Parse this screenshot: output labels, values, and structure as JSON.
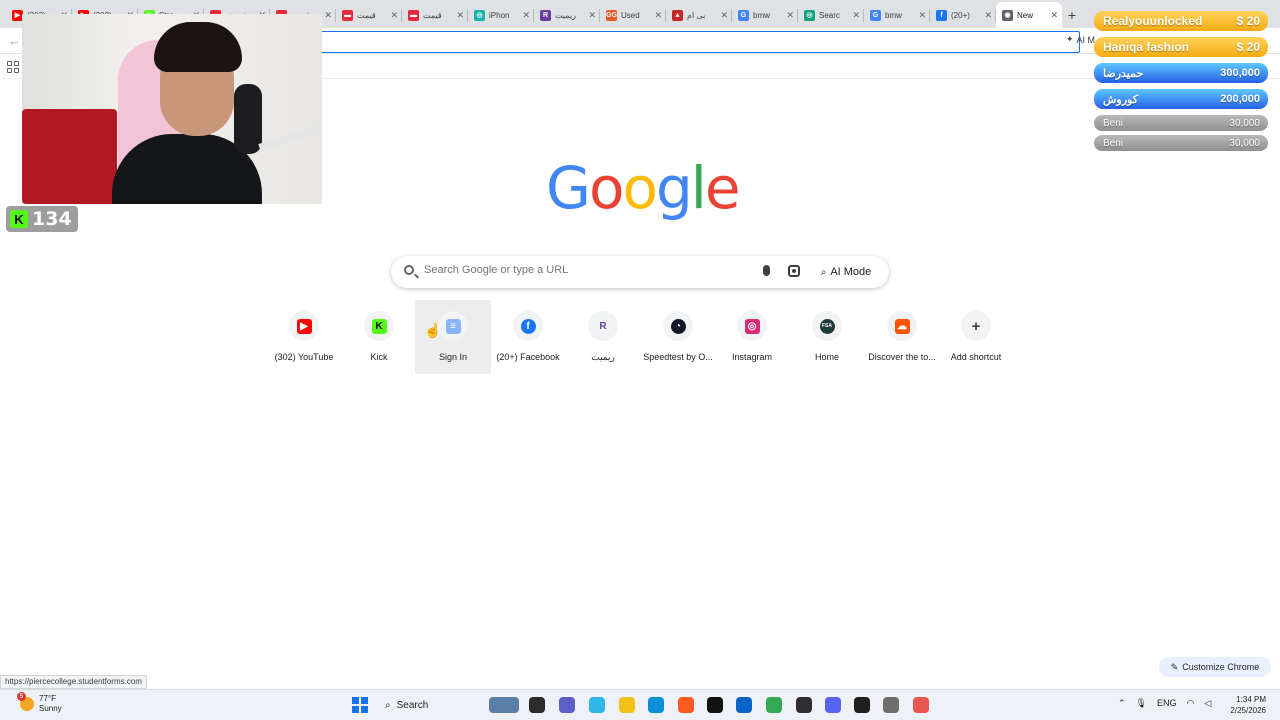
{
  "tabs": [
    {
      "title": "(303)",
      "color": "#ff0000",
      "glyph": "▶"
    },
    {
      "title": "(303)",
      "color": "#ff0000",
      "glyph": "▶"
    },
    {
      "title": "Stre",
      "color": "#53fc18",
      "glyph": "K"
    },
    {
      "title": "فروش",
      "color": "#e8283c",
      "glyph": "▬"
    },
    {
      "title": "قیمت",
      "color": "#e8283c",
      "glyph": "▬"
    },
    {
      "title": "قیمت",
      "color": "#e8283c",
      "glyph": "▬"
    },
    {
      "title": "قیمت",
      "color": "#e8283c",
      "glyph": "▬"
    },
    {
      "title": "iPhon",
      "color": "#16b3a8",
      "glyph": "◎"
    },
    {
      "title": "ریمیت",
      "color": "#6b3fa0",
      "glyph": "R"
    },
    {
      "title": "Used",
      "color": "#e85a2a",
      "glyph": "GG"
    },
    {
      "title": "بی ام",
      "color": "#c62828",
      "glyph": "▲"
    },
    {
      "title": "bmw",
      "color": "#4285f4",
      "glyph": "G"
    },
    {
      "title": "Searc",
      "color": "#10a37f",
      "glyph": "◎"
    },
    {
      "title": "bmw",
      "color": "#4285f4",
      "glyph": "G"
    },
    {
      "title": "(20+)",
      "color": "#1877f2",
      "glyph": "f"
    },
    {
      "title": "New",
      "color": "#5f6368",
      "glyph": "◉",
      "active": true
    }
  ],
  "toolbar": {
    "ai_label": "AI M"
  },
  "stream": {
    "viewer_count": "134"
  },
  "donations": [
    {
      "name": "Realyouunlocked",
      "amount": "$ 20",
      "style": "gold"
    },
    {
      "name": "Haniqa fashion",
      "amount": "$ 20",
      "style": "gold"
    },
    {
      "name": "حمیدرضا",
      "amount": "300,000",
      "style": "blue"
    },
    {
      "name": "کوروش",
      "amount": "200,000",
      "style": "blue"
    },
    {
      "name": "Beni",
      "amount": "30,000",
      "style": "gray"
    },
    {
      "name": "Beni",
      "amount": "30,000",
      "style": "gray"
    }
  ],
  "google": {
    "logo_letters": [
      {
        "ch": "G",
        "color": "#4285f4"
      },
      {
        "ch": "o",
        "color": "#ea4335"
      },
      {
        "ch": "o",
        "color": "#fbbc05"
      },
      {
        "ch": "g",
        "color": "#4285f4"
      },
      {
        "ch": "l",
        "color": "#34a853"
      },
      {
        "ch": "e",
        "color": "#ea4335"
      }
    ],
    "search_placeholder": "Search Google or type a URL",
    "ai_mode_label": "AI Mode"
  },
  "shortcuts": [
    {
      "label": "(302) YouTube",
      "icon": "youtube-icon",
      "color": "#ff0000",
      "glyph": "▶"
    },
    {
      "label": "Kick",
      "icon": "kick-icon",
      "color": "#53fc18",
      "glyph": "K"
    },
    {
      "label": "Sign In",
      "icon": "forms-icon",
      "color": "#8ab4f8",
      "glyph": "≡",
      "hover": true
    },
    {
      "label": "(20+) Facebook",
      "icon": "facebook-icon",
      "color": "#1877f2",
      "glyph": "f"
    },
    {
      "label": "ریمیت",
      "icon": "remit-icon",
      "color": "#f1f3f4",
      "glyph": "R"
    },
    {
      "label": "Speedtest by O...",
      "icon": "speedtest-icon",
      "color": "#141526",
      "glyph": "◔"
    },
    {
      "label": "Instagram",
      "icon": "instagram-icon",
      "color": "#d62976",
      "glyph": "◎"
    },
    {
      "label": "Home",
      "icon": "fsa-icon",
      "color": "#1f3a3a",
      "glyph": "FSA"
    },
    {
      "label": "Discover the to...",
      "icon": "soundcloud-icon",
      "color": "#ff5500",
      "glyph": "☁"
    },
    {
      "label": "Add shortcut",
      "icon": "plus-icon",
      "color": "#f1f3f4",
      "glyph": "+"
    }
  ],
  "status_url": "https://piercecollege.studentforms.com",
  "customize_label": "Customize Chrome",
  "taskbar": {
    "weather_temp": "77°F",
    "weather_desc": "Sunny",
    "weather_badge": "5",
    "search_label": "Search",
    "lang": "ENG",
    "time": "1:34 PM",
    "date": "2/25/2026",
    "apps": [
      {
        "name": "widgets-app-icon",
        "color": "#5b7fa8"
      },
      {
        "name": "terminal-app-icon",
        "color": "#2b2b2b"
      },
      {
        "name": "teams-app-icon",
        "color": "#5b5fc7"
      },
      {
        "name": "copilot-app-icon",
        "color": "#2fb8e8"
      },
      {
        "name": "file-explorer-icon",
        "color": "#f3c019"
      },
      {
        "name": "edge-app-icon",
        "color": "#0c8fd8"
      },
      {
        "name": "brave-app-icon",
        "color": "#ff5a1f"
      },
      {
        "name": "tiktok-app-icon",
        "color": "#111111"
      },
      {
        "name": "outlook-app-icon",
        "color": "#0a64c8"
      },
      {
        "name": "chrome-app-icon",
        "color": "#34a853"
      },
      {
        "name": "obs-app-icon",
        "color": "#302e31"
      },
      {
        "name": "discord-app-icon",
        "color": "#5865f2"
      },
      {
        "name": "chatgpt-app-icon",
        "color": "#1f1f1f"
      },
      {
        "name": "calculator-app-icon",
        "color": "#6e6e6e"
      },
      {
        "name": "snipping-app-icon",
        "color": "#e8574f"
      }
    ]
  }
}
